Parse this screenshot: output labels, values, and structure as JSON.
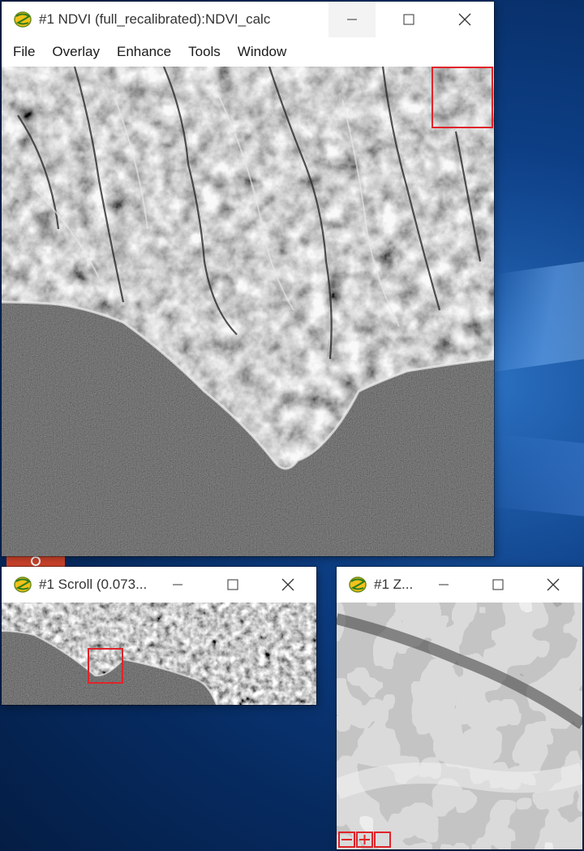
{
  "windows": {
    "main": {
      "title": "#1 NDVI (full_recalibrated):NDVI_calc",
      "menu": [
        "File",
        "Overlay",
        "Enhance",
        "Tools",
        "Window"
      ]
    },
    "scroll": {
      "title": "#1 Scroll (0.073..."
    },
    "zoom": {
      "title": "#1 Z..."
    }
  },
  "icons": {
    "app": "envi-globe-icon",
    "minimize": "minimize-icon",
    "maximize": "maximize-icon",
    "close": "close-icon"
  },
  "colors": {
    "roi_box": "#e0242a",
    "desktop": "#0d3f86"
  }
}
